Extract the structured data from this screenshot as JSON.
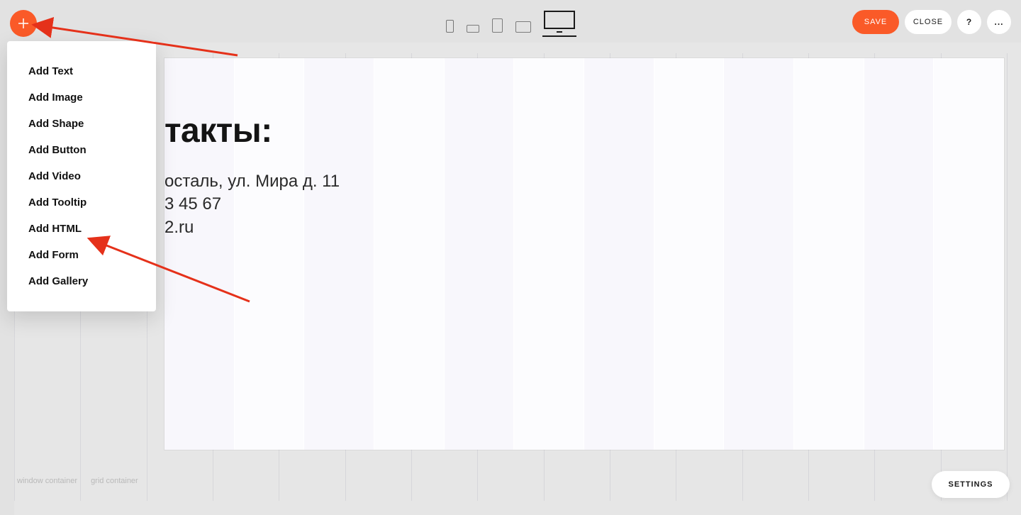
{
  "toolbar": {
    "save_label": "SAVE",
    "close_label": "CLOSE",
    "help_label": "?",
    "more_label": "...",
    "devices": [
      "mobile-portrait",
      "mobile-landscape",
      "tablet-portrait",
      "tablet-landscape",
      "desktop"
    ],
    "device_active_index": 4
  },
  "add_menu": {
    "items": [
      "Add Text",
      "Add Image",
      "Add Shape",
      "Add Button",
      "Add Video",
      "Add Tooltip",
      "Add HTML",
      "Add Form",
      "Add Gallery"
    ]
  },
  "canvas": {
    "heading": "такты:",
    "body_lines": "осталь, ул. Мира д. 11\n3 45 67\n2.ru"
  },
  "breadcrumbs": {
    "item0": "window container",
    "item1": "grid container"
  },
  "settings_label": "SETTINGS",
  "colors": {
    "accent": "#fa5a28"
  }
}
